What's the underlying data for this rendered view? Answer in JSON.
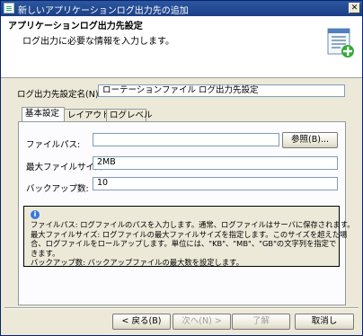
{
  "window": {
    "title": "新しいアプリケーションログ出力先の追加",
    "close_glyph": "✕"
  },
  "banner": {
    "title": "アプリケーションログ出力先設定",
    "subtitle": "ログ出力に必要な情報を入力します。",
    "icon": "document-add-icon"
  },
  "name_field": {
    "label": "ログ出力先設定名(N):",
    "value": "ローテーションファイル ログ出力先設定"
  },
  "tabs": [
    {
      "label": "基本設定",
      "active": true
    },
    {
      "label": "レイアウト",
      "active": false
    },
    {
      "label": "ログレベル",
      "active": false
    }
  ],
  "basic": {
    "file_path_label": "ファイルパス:",
    "file_path_value": "",
    "browse_label": "参照(B)...",
    "max_size_label": "最大ファイルサイズ:",
    "max_size_value": "2MB",
    "backup_count_label": "バックアップ数:",
    "backup_count_value": "10"
  },
  "info": {
    "lines": [
      "ファイルパス: ログファイルのパスを入力します。通常、ログファイルはサーバに保存されます。",
      "最大ファイルサイズ: ログファイルの最大ファイルサイズを指定します。このサイズを超えた場",
      "合、ログファイルをロールアップします。単位には、\"KB\"、\"MB\"、\"GB\"の文字列を指定で",
      "きます。",
      "バックアップ数: バックアップファイルの最大数を設定します。"
    ]
  },
  "buttons": {
    "back": "< 戻る(B)",
    "next": "次へ(N) >",
    "finish": "了解",
    "cancel": "取消し"
  }
}
